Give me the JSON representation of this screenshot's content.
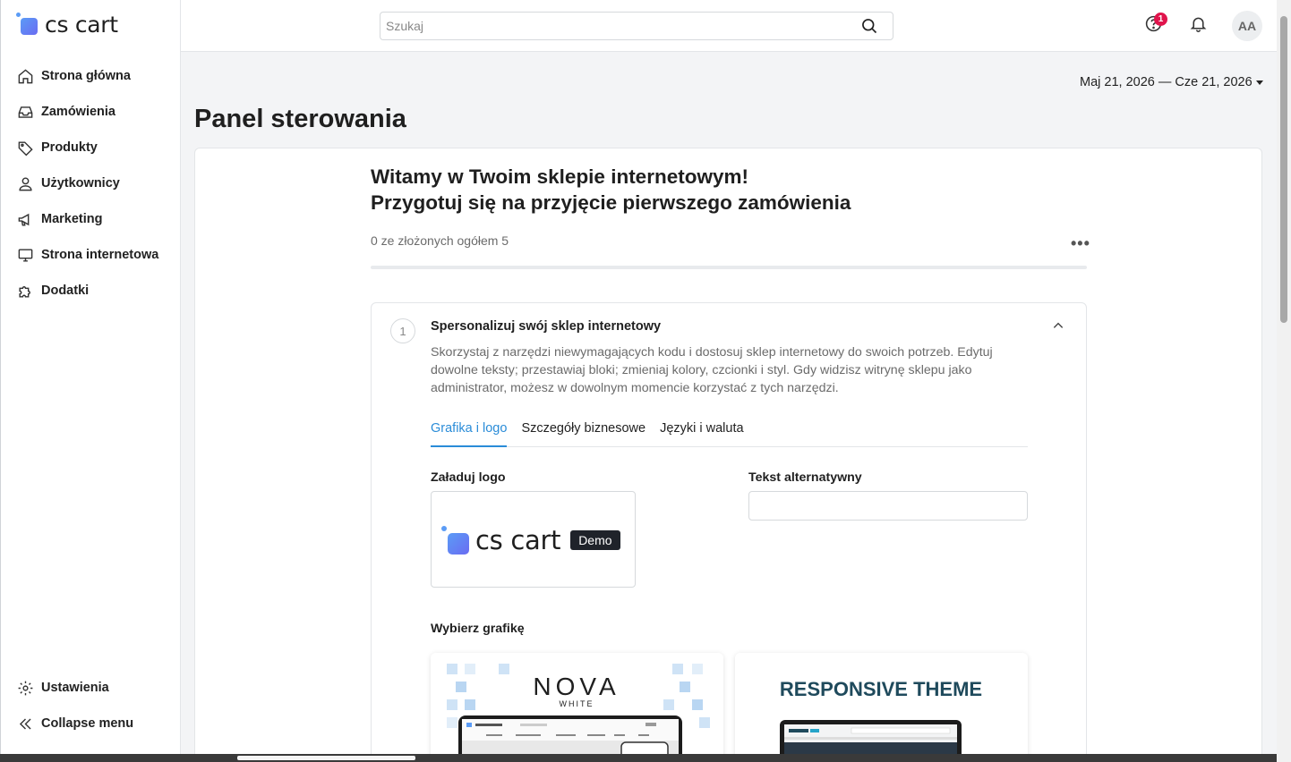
{
  "app": {
    "logo_text": "cs cart"
  },
  "sidebar": {
    "items": [
      {
        "label": "Strona główna",
        "icon": "home-icon"
      },
      {
        "label": "Zamówienia",
        "icon": "inbox-icon"
      },
      {
        "label": "Produkty",
        "icon": "tag-icon"
      },
      {
        "label": "Użytkownicy",
        "icon": "user-icon"
      },
      {
        "label": "Marketing",
        "icon": "megaphone-icon"
      },
      {
        "label": "Strona internetowa",
        "icon": "monitor-icon"
      },
      {
        "label": "Dodatki",
        "icon": "puzzle-icon"
      }
    ],
    "bottom": [
      {
        "label": "Ustawienia",
        "icon": "gear-icon"
      },
      {
        "label": "Collapse menu",
        "icon": "double-chevron-left-icon"
      }
    ]
  },
  "topbar": {
    "search_placeholder": "Szukaj",
    "help_badge": "1",
    "avatar_initials": "AA"
  },
  "main": {
    "date_range": "Maj 21, 2026 — Cze 21, 2026",
    "page_title": "Panel sterowania",
    "welcome_line1": "Witamy w Twoim sklepie internetowym!",
    "welcome_line2": "Przygotuj się na przyjęcie pierwszego zamówienia",
    "progress_text": "0 ze złożonych ogółem 5",
    "progress_value": 0,
    "more_label": "•••"
  },
  "step": {
    "number": "1",
    "title": "Spersonalizuj swój sklep internetowy",
    "description": "Skorzystaj z narzędzi niewymagających kodu i dostosuj sklep internetowy do swoich potrzeb. Edytuj dowolne teksty; przestawiaj bloki; zmieniaj kolory, czcionki i styl. Gdy widzisz witrynę sklepu jako administrator, możesz w dowolnym momencie korzystać z tych narzędzi.",
    "tabs": [
      "Grafika i logo",
      "Szczegóły biznesowe",
      "Języki i waluta"
    ],
    "active_tab": "Grafika i logo",
    "upload_logo_label": "Załaduj logo",
    "logo_preview_text": "cs cart",
    "logo_demo_tag": "Demo",
    "alt_text_label": "Tekst alternatywny",
    "alt_text_value": "",
    "choose_theme_label": "Wybierz grafikę",
    "themes": [
      {
        "title": "NOVA",
        "subtitle": "WHITE"
      },
      {
        "title": "RESPONSIVE THEME",
        "subtitle": ""
      }
    ]
  },
  "colors": {
    "accent": "#2a8cd8",
    "badge": "#e0144c",
    "logo_gradient_start": "#5b9cf6",
    "logo_gradient_end": "#6a6cf2"
  }
}
